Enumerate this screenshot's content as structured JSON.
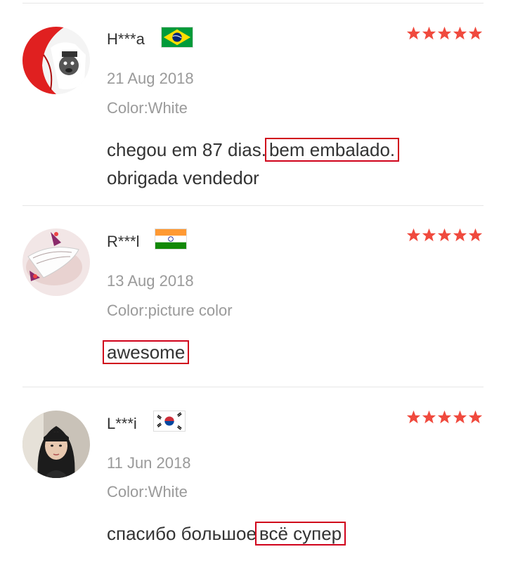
{
  "reviews": [
    {
      "name": "H***a",
      "country_flag": "brazil-flag",
      "rating": 5,
      "date": "21 Aug 2018",
      "color": "Color:White",
      "text_plain": "chegou em 87 dias.",
      "text_highlight": "bem embalado.",
      "text_line2": "obrigada vendedor"
    },
    {
      "name": "R***l",
      "country_flag": "india-flag",
      "rating": 5,
      "date": "13 Aug 2018",
      "color": "Color:picture color",
      "text_highlight": "awesome"
    },
    {
      "name": "L***i",
      "country_flag": "south-korea-flag",
      "rating": 5,
      "date": "11 Jun 2018",
      "color": "Color:White",
      "text_plain": "спасибо большое",
      "text_highlight": "всё супер"
    }
  ],
  "colors": {
    "star": "#f04a3e",
    "highlight_border": "#d0021b",
    "meta_text": "#9a9a9a"
  }
}
